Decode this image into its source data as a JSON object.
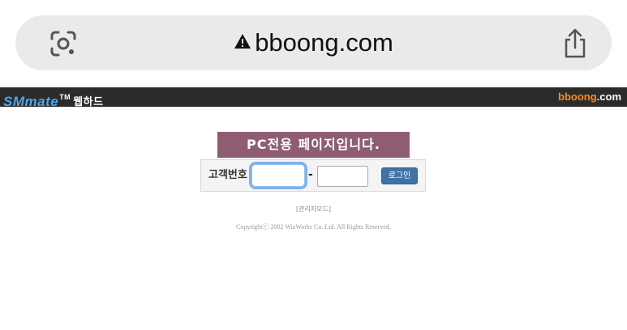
{
  "browser": {
    "url": "bboong.com",
    "icons": {
      "lens": "google-lens-icon",
      "warning": "warning-triangle-icon",
      "share": "share-icon"
    }
  },
  "header": {
    "brand": "SMmate",
    "trademark": "TM",
    "brand_sub": "웹하드",
    "domain_part1": "bboong",
    "domain_part2": ".com",
    "colors": {
      "bar": "#2b2b2b",
      "brand": "#4ea6e8",
      "domain_accent": "#ff8a1c"
    }
  },
  "main": {
    "notice": "PC전용 페이지입니다.",
    "login": {
      "label": "고객번호",
      "field1_value": "",
      "separator": "-",
      "field2_value": "",
      "button_label": "로그인"
    },
    "admin_link": "[관리자모드]",
    "copyright": "Copyrightⓒ 2002 WizWorks Co. Ltd. All Rights Reserved."
  }
}
